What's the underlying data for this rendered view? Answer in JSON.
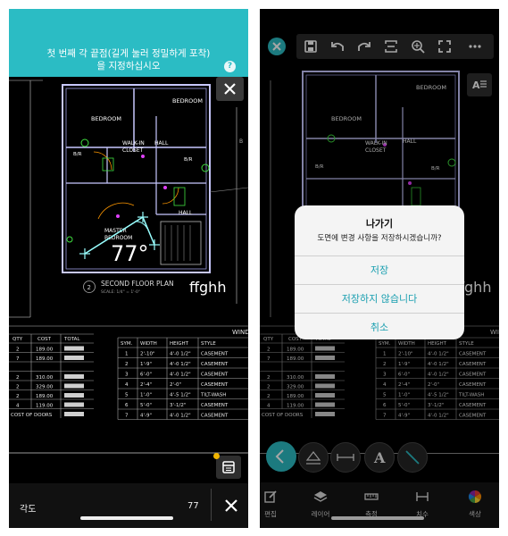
{
  "left_screen": {
    "banner": {
      "line1": "첫 번째 각 끝점(길게 눌러 정밀하게 포착)",
      "line2": "을 지정하십시오",
      "help_icon": "question-icon"
    },
    "drawing": {
      "rooms": [
        "BEDROOM",
        "BEDROOM",
        "WALK-IN",
        "CLOSET",
        "HALL",
        "B/R",
        "B/R",
        "HALL",
        "MASTER",
        "BEDROOM"
      ],
      "plan_number": "2",
      "plan_title": "SECOND FLOOR PLAN",
      "plan_scale": "SCALE: 1/4\" = 1'-0\"",
      "annotation": "ffghh",
      "angle_display": "77°"
    },
    "left_table": {
      "headers": [
        "QTY",
        "COST",
        "TOTAL"
      ],
      "qty": [
        "2",
        "7",
        "",
        "2",
        "2",
        "2",
        "4"
      ],
      "cost": [
        "189.00",
        "189.00",
        "",
        "310.00",
        "329.00",
        "189.00",
        "119.00"
      ],
      "footer": "COST OF DOORS"
    },
    "window_table": {
      "title": "WINDOW",
      "headers": [
        "SYM.",
        "WIDTH",
        "HEIGHT",
        "STYLE"
      ],
      "rows": [
        [
          "1",
          "2'-10\"",
          "4'-0 1/2\"",
          "CASEMENT"
        ],
        [
          "2",
          "1'-9\"",
          "4'-0 1/2\"",
          "CASEMENT"
        ],
        [
          "3",
          "6'-0\"",
          "4'-0 1/2\"",
          "CASEMENT"
        ],
        [
          "4",
          "2'-4\"",
          "2'-0\"",
          "CASEMENT"
        ],
        [
          "5",
          "1'-0\"",
          "4'-5 1/2\"",
          "TILT-WASH"
        ],
        [
          "6",
          "5'-0\"",
          "3'-1/2\"",
          "CASEMENT"
        ],
        [
          "7",
          "4'-9\"",
          "4'-0 1/2\"",
          "CASEMENT"
        ]
      ]
    },
    "bottom_bar": {
      "label": "각도",
      "value": "77"
    }
  },
  "right_screen": {
    "toolbar": [
      "save-icon",
      "undo-icon",
      "redo-icon",
      "scan-icon",
      "zoom-icon",
      "fullscreen-icon",
      "more-icon"
    ],
    "dialog": {
      "title": "나가기",
      "message": "도면에 변경 사항을 저장하시겠습니까?",
      "save": "저장",
      "dont_save": "저장하지 않습니다",
      "cancel": "취소"
    },
    "tool_text_glyph": "A",
    "bottom_nav": [
      {
        "label": "편집",
        "icon": "edit-icon"
      },
      {
        "label": "레이어",
        "icon": "layers-icon"
      },
      {
        "label": "측정",
        "icon": "ruler-icon"
      },
      {
        "label": "치수",
        "icon": "dimension-icon"
      },
      {
        "label": "색상",
        "icon": "color-wheel-icon"
      }
    ]
  },
  "colors": {
    "accent": "#2bbcc4",
    "wall": "#c8c8ff",
    "magenta": "#e040fb",
    "green": "#40e040",
    "orange": "#ff9800",
    "background": "#000000"
  }
}
